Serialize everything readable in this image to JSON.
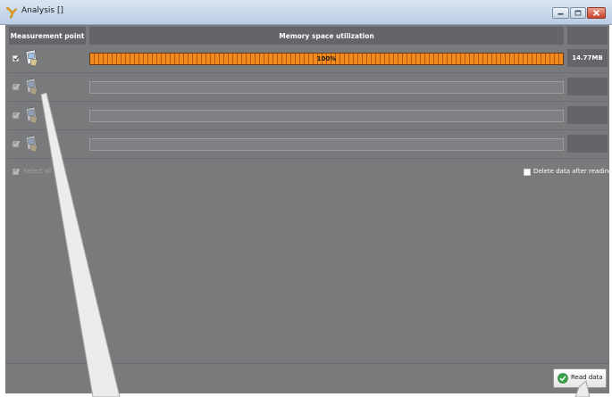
{
  "window": {
    "title": "Analysis []",
    "icon": "app-logo-icon",
    "controls": [
      "minimize-icon",
      "maximize-icon",
      "close-icon"
    ]
  },
  "table": {
    "headers": {
      "measurement_point": "Measurement point",
      "memory": "Memory space utilization",
      "size": ""
    },
    "rows": [
      {
        "checked": true,
        "enabled": true,
        "icon": "measurement-device-icon",
        "progress": 1.0,
        "percent_label": "100%",
        "size": "14.77MB"
      },
      {
        "checked": true,
        "enabled": false,
        "icon": "measurement-device-icon",
        "progress": 0,
        "percent_label": "",
        "size": ""
      },
      {
        "checked": true,
        "enabled": false,
        "icon": "measurement-device-icon",
        "progress": 0,
        "percent_label": "",
        "size": ""
      },
      {
        "checked": true,
        "enabled": false,
        "icon": "measurement-device-icon",
        "progress": 0,
        "percent_label": "",
        "size": ""
      }
    ]
  },
  "select_all": {
    "label": "Select all",
    "checked": true,
    "enabled": false
  },
  "delete_option": {
    "label": "Delete data after reading",
    "checked": false
  },
  "read_button": {
    "label": "Read data",
    "icon": "green-check-icon"
  },
  "colors": {
    "progress": "#f08a1e",
    "background": "#797a7c",
    "header": "#646568"
  }
}
